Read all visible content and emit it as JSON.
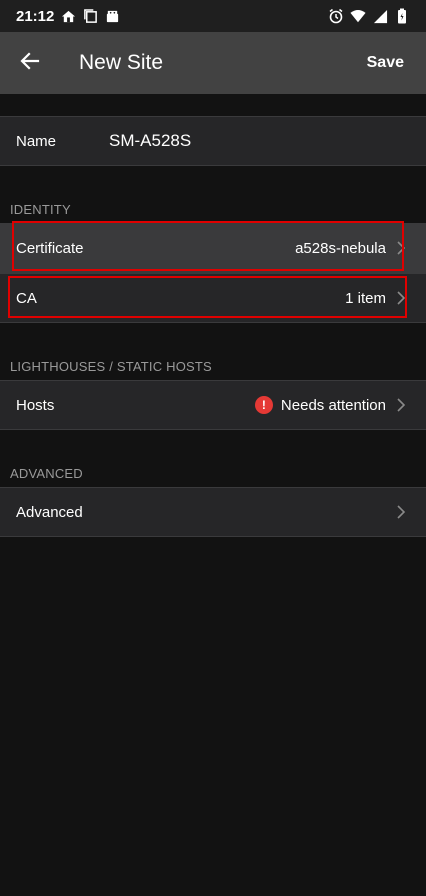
{
  "status_bar": {
    "time": "21:12",
    "left_icons": [
      "home-icon",
      "copy-icon",
      "android-icon"
    ],
    "right_icons": [
      "alarm-icon",
      "wifi-icon",
      "signal-icon",
      "battery-icon"
    ]
  },
  "app_bar": {
    "title": "New Site",
    "save_label": "Save",
    "back_icon": "back-arrow-icon"
  },
  "name_row": {
    "label": "Name",
    "value": "SM-A528S"
  },
  "identity": {
    "header": "IDENTITY",
    "certificate": {
      "label": "Certificate",
      "value": "a528s-nebula"
    },
    "ca": {
      "label": "CA",
      "value": "1 item"
    }
  },
  "lighthouses": {
    "header": "LIGHTHOUSES / STATIC HOSTS",
    "hosts": {
      "label": "Hosts",
      "value": "Needs attention",
      "badge_symbol": "!"
    }
  },
  "advanced": {
    "header": "ADVANCED",
    "row": {
      "label": "Advanced"
    }
  },
  "colors": {
    "background": "#121212",
    "app_bar": "#424242",
    "row": "#262628",
    "highlight": "#e00000",
    "warning": "#e53935"
  }
}
